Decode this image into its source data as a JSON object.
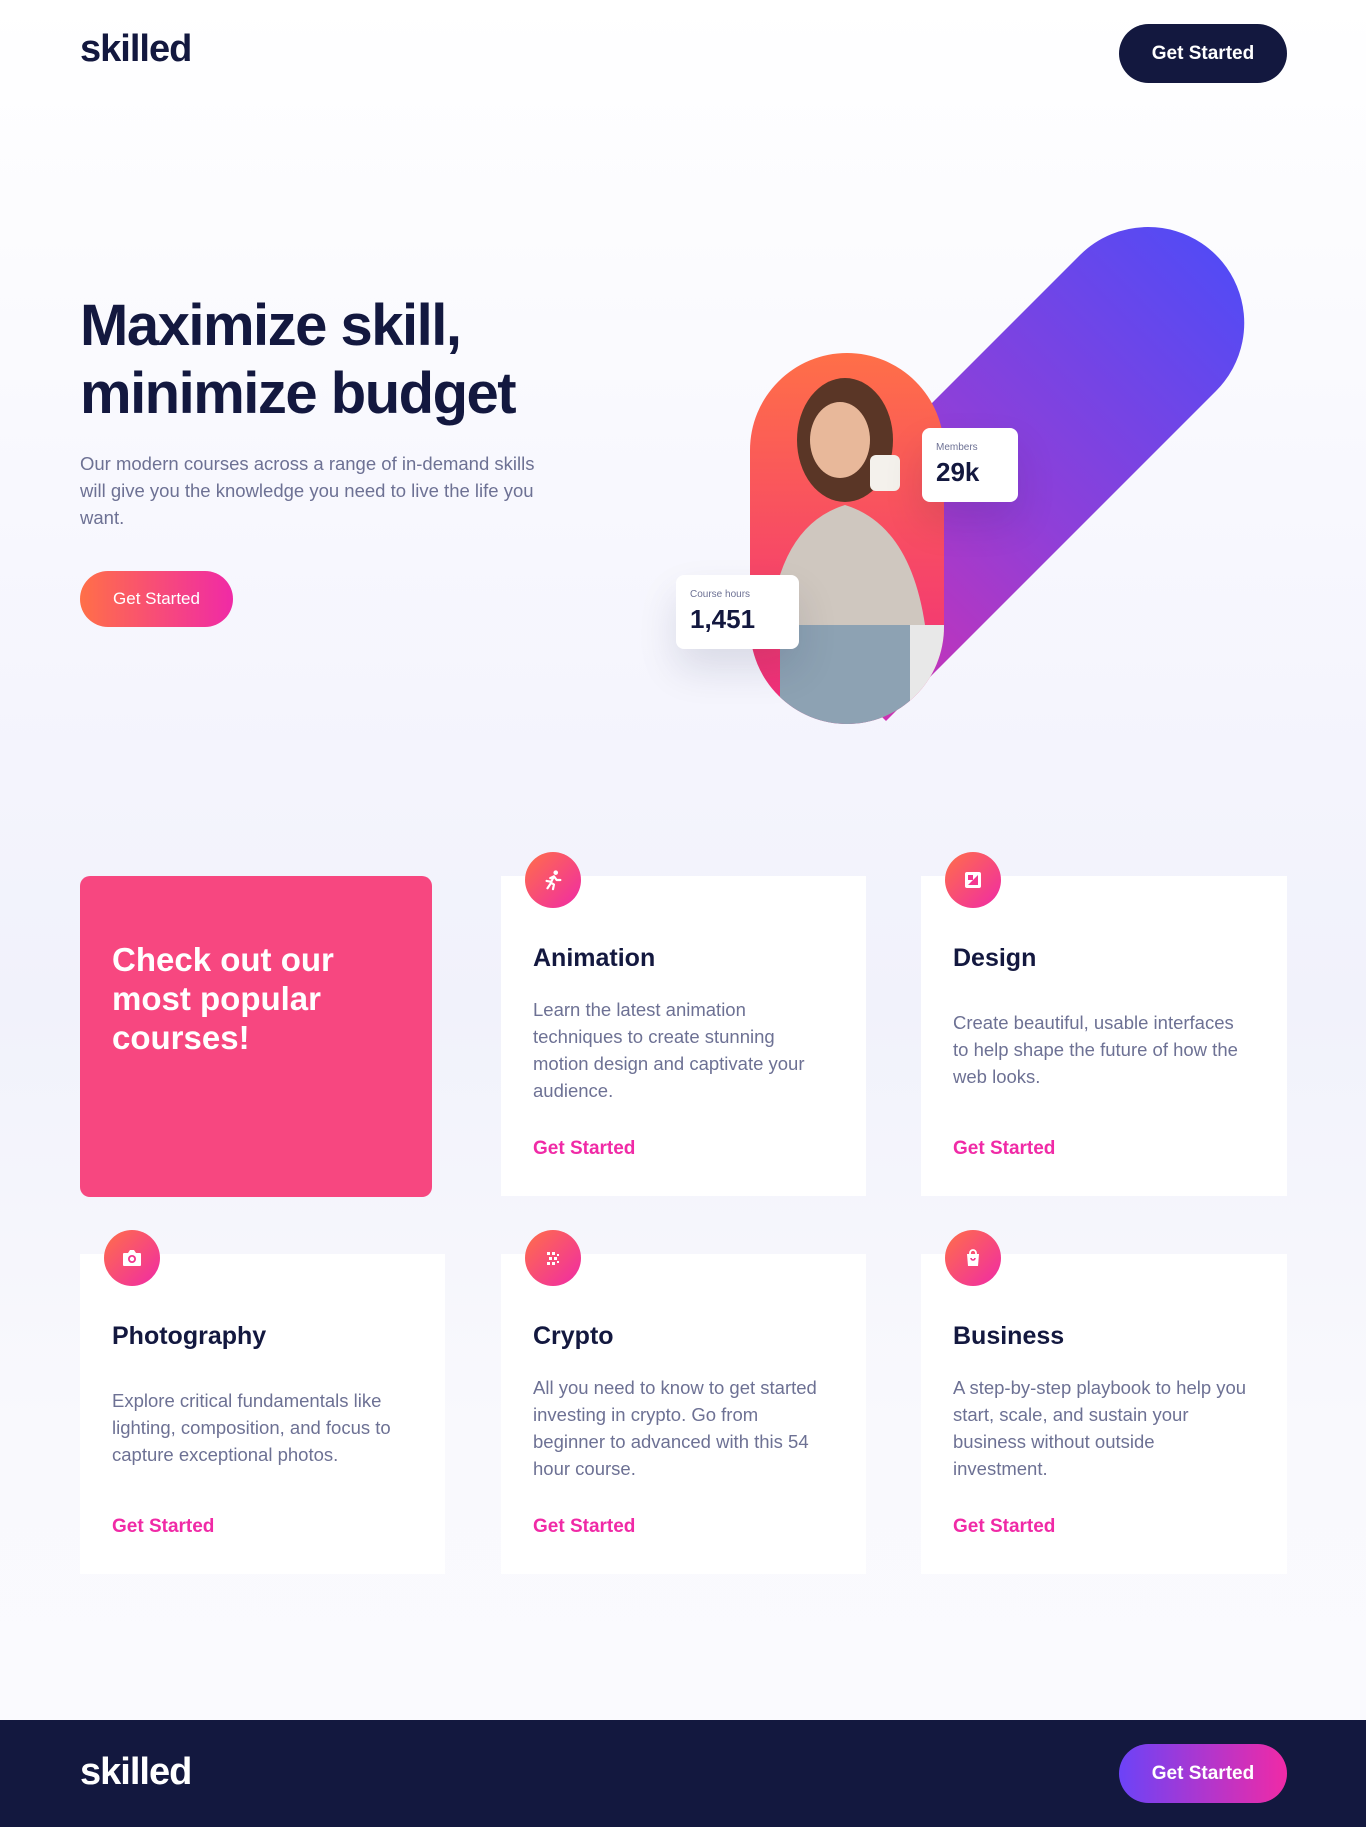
{
  "header": {
    "logo": "skilled",
    "cta_label": "Get Started"
  },
  "hero": {
    "title_line1": "Maximize skill,",
    "title_line2": "minimize budget",
    "text": "Our modern courses across a range of in-demand skills will give you the knowledge you need to live the life you want.",
    "cta_label": "Get Started",
    "stats": {
      "members_label": "Members",
      "members_value": "29k",
      "hours_label": "Course hours",
      "hours_value": "1,451"
    }
  },
  "promo": {
    "text": "Check out our most popular courses!"
  },
  "courses": [
    {
      "title": "Animation",
      "icon": "running-person-icon",
      "text": "Learn the latest animation techniques to create stunning motion design and captivate your audience.",
      "cta": "Get Started"
    },
    {
      "title": "Design",
      "icon": "design-frame-icon",
      "text": "Create beautiful, usable interfaces to help shape the future of how the web looks.",
      "cta": "Get Started"
    },
    {
      "title": "Photography",
      "icon": "camera-icon",
      "text": "Explore critical fundamentals like lighting, composition, and focus to capture exceptional photos.",
      "cta": "Get Started"
    },
    {
      "title": "Crypto",
      "icon": "crypto-dots-icon",
      "text": "All you need to know to get started investing in crypto. Go from beginner to advanced with this 54 hour course.",
      "cta": "Get Started"
    },
    {
      "title": "Business",
      "icon": "shopping-bag-icon",
      "text": "A step-by-step playbook to help you start, scale, and sustain your business without outside investment.",
      "cta": "Get Started"
    }
  ],
  "footer": {
    "logo": "skilled",
    "cta_label": "Get Started"
  },
  "colors": {
    "navy": "#13183F",
    "pink": "#F02AA6",
    "orange": "#FF6F48",
    "purple": "#6C43F7",
    "gray_text": "#6D7194",
    "promo": "#F74780"
  }
}
